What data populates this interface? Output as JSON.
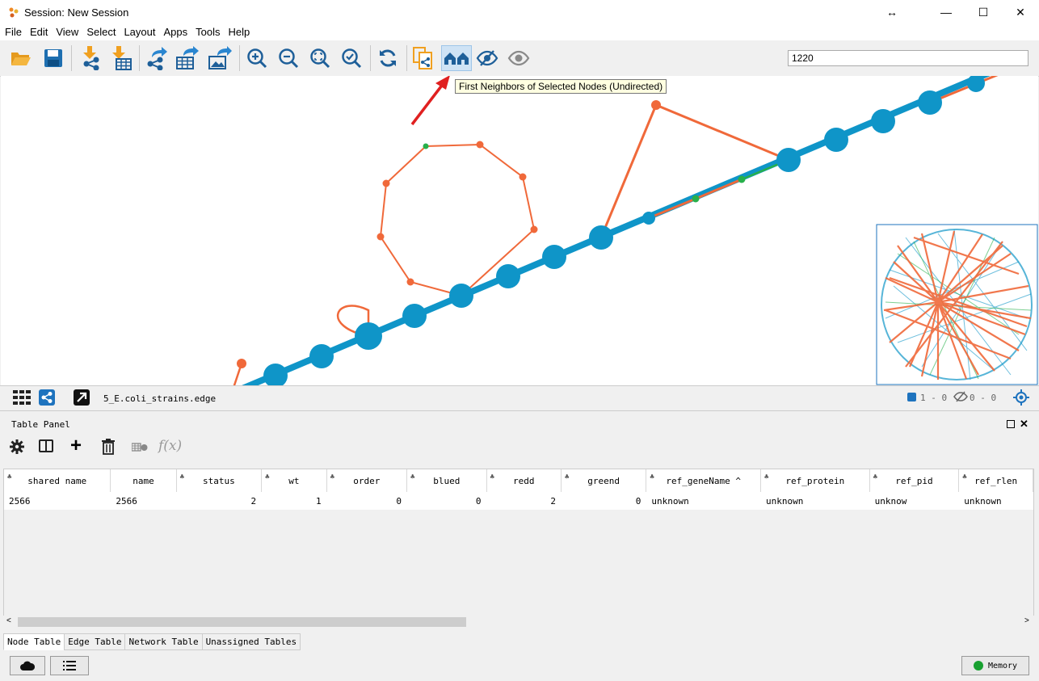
{
  "window": {
    "title": "Session: New Session"
  },
  "menu": [
    "File",
    "Edit",
    "View",
    "Select",
    "Layout",
    "Apps",
    "Tools",
    "Help"
  ],
  "toolbar": {
    "search_value": "1220",
    "tooltip": "First Neighbors of Selected Nodes (Undirected)"
  },
  "network": {
    "name": "5_E.coli_strains.edge",
    "selected_nodes": "1 - 0",
    "hidden": "0 - 0"
  },
  "table_panel": {
    "title": "Table Panel",
    "columns": [
      "shared name",
      "name",
      "status",
      "wt",
      "order",
      "blued",
      "redd",
      "greend",
      "ref_geneName",
      "ref_protein",
      "ref_pid",
      "ref_rlen"
    ],
    "rows": [
      [
        "2566",
        "2566",
        "2",
        "1",
        "0",
        "0",
        "2",
        "0",
        "unknown",
        "unknown",
        "unknow",
        "unknown"
      ]
    ],
    "tabs": [
      "Node Table",
      "Edge Table",
      "Network Table",
      "Unassigned Tables"
    ]
  },
  "status": {
    "memory_label": "Memory"
  },
  "colors": {
    "node_blue": "#0f95c8",
    "node_orange": "#f0693a",
    "node_green": "#27b04b",
    "accent": "#1e73be"
  }
}
